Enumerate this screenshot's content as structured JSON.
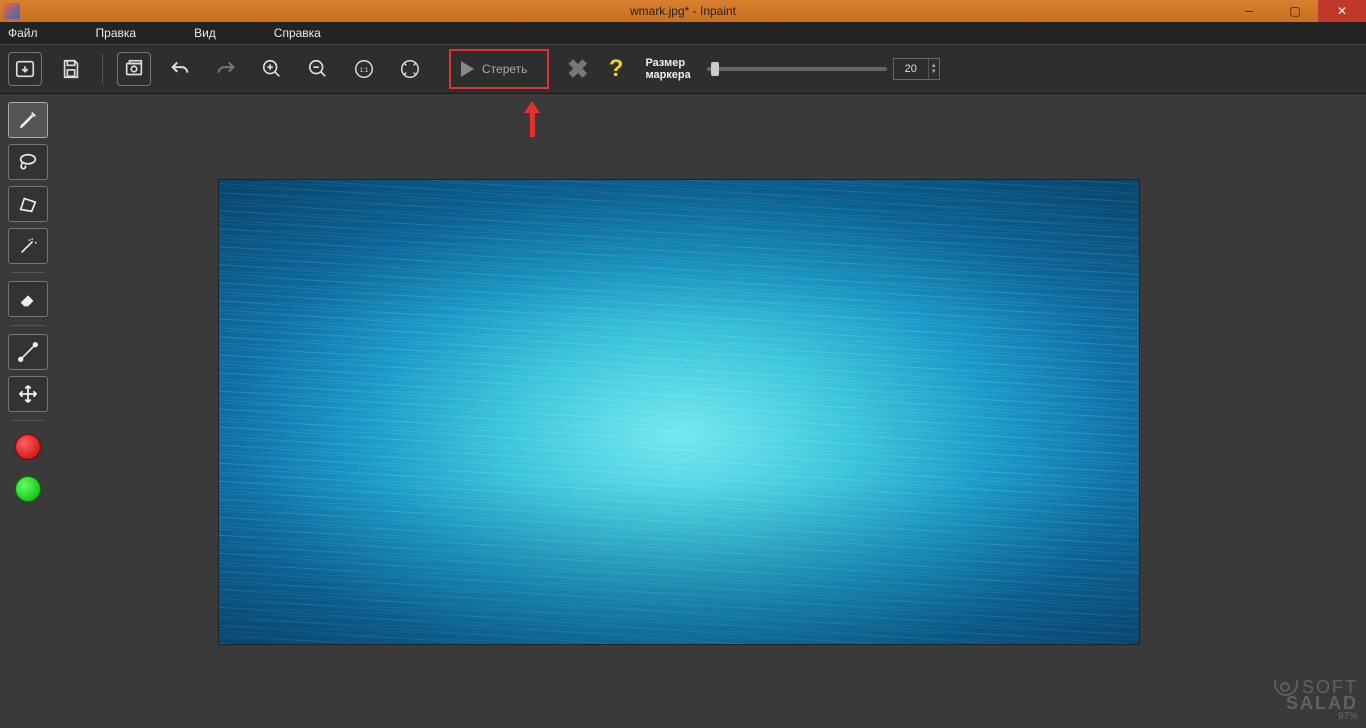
{
  "window": {
    "title": "wmark.jpg* - Inpaint"
  },
  "menu": {
    "file": "Файл",
    "edit": "Правка",
    "view": "Вид",
    "help": "Справка"
  },
  "toolbar": {
    "erase_label": "Стереть",
    "marker_label_line1": "Размер",
    "marker_label_line2": "маркера",
    "marker_value": "20"
  },
  "watermark": {
    "brand_soft": "SOFT",
    "brand_salad": "SALAD",
    "percent": "97%"
  }
}
